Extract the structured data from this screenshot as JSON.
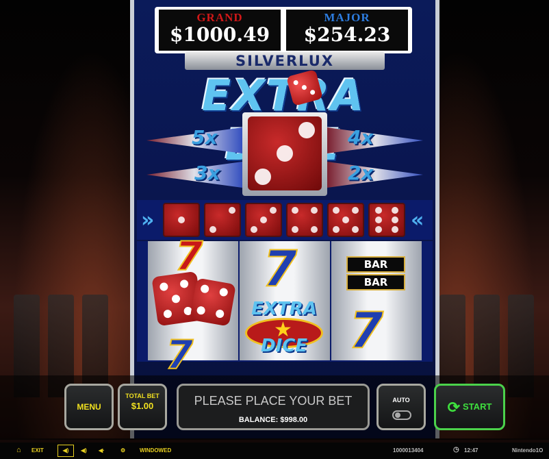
{
  "jackpots": {
    "grand_label": "GRAND",
    "grand_value": "$1000.49",
    "major_label": "MAJOR",
    "major_value": "$254.23"
  },
  "brand": "SILVERLUX",
  "game_title": "EXTRA DICE",
  "multipliers": {
    "top_left": "5x",
    "top_right": "4x",
    "bottom_left": "3x",
    "bottom_right": "2x"
  },
  "reels": {
    "reel2_symbol": "7",
    "extra_dice_symbol": [
      "EXTRA",
      "DICE"
    ],
    "bar_label": "BAR"
  },
  "controls": {
    "menu_label": "MENU",
    "total_bet_label": "TOTAL BET",
    "total_bet_value": "$1.00",
    "message": "PLEASE PLACE YOUR BET",
    "balance": "BALANCE: $998.00",
    "auto_label": "AUTO",
    "start_label": "START"
  },
  "status_bar": {
    "exit_label": "EXIT",
    "windowed_label": "WINDOWED",
    "ticket": "1000013404",
    "clock": "12:47",
    "provider": "Nintendo1O"
  },
  "colors": {
    "accent_yellow": "#f0e020",
    "start_green": "#3ee03e",
    "cabinet_blue": "#0b1b5a",
    "grand_red": "#d01818",
    "major_blue": "#2d7de0"
  }
}
